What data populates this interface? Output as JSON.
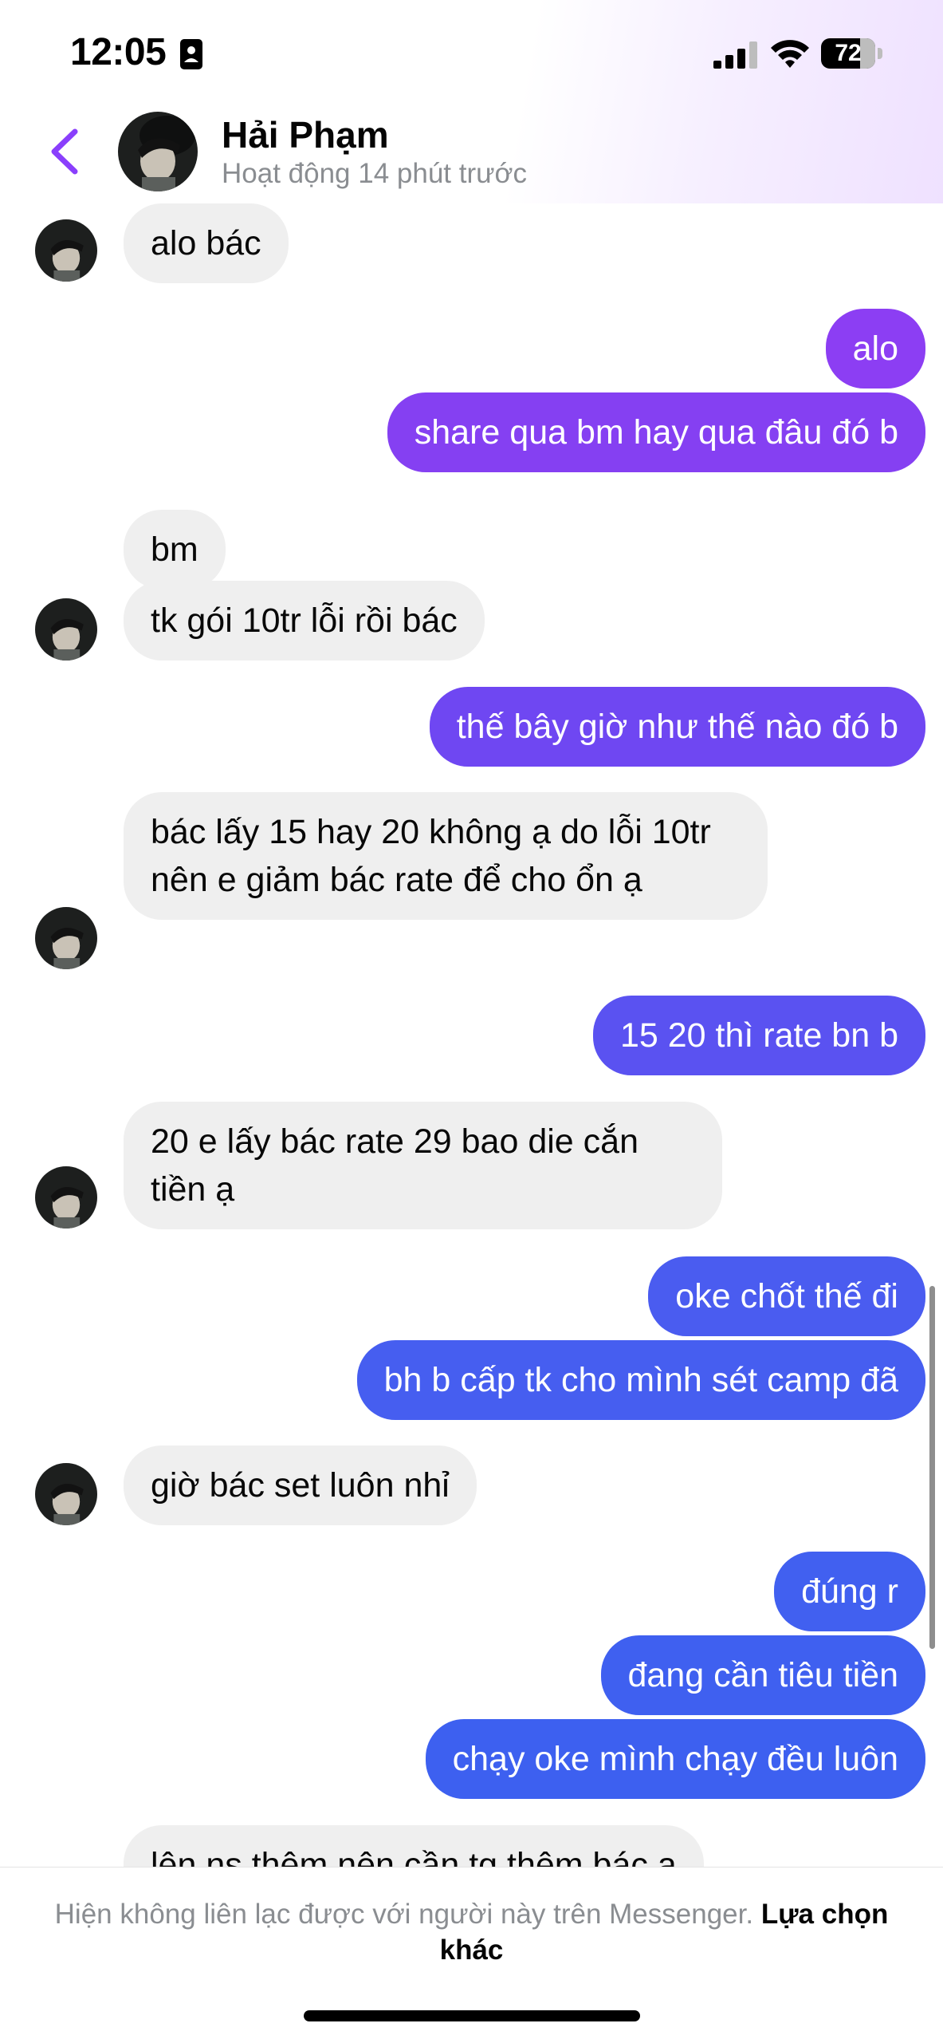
{
  "status_bar": {
    "time": "12:05",
    "battery_level": "72",
    "battery_fraction": 0.72
  },
  "header": {
    "contact_name": "Hải Phạm",
    "contact_status": "Hoạt động 14 phút trước"
  },
  "messages": [
    {
      "sender": "them",
      "text": "alo bác"
    },
    {
      "sender": "me",
      "text": "alo"
    },
    {
      "sender": "me",
      "text": "share qua bm hay qua đâu đó b"
    },
    {
      "sender": "them",
      "text": "bm"
    },
    {
      "sender": "them",
      "text": "tk gói 10tr lỗi rồi bác"
    },
    {
      "sender": "me",
      "text": "thế bây giờ như thế nào đó b"
    },
    {
      "sender": "them",
      "text": "bác lấy 15 hay 20 không ạ do lỗi 10tr nên e giảm bác rate để cho ổn ạ"
    },
    {
      "sender": "me",
      "text": "15 20 thì rate bn b"
    },
    {
      "sender": "them",
      "text": "20 e lấy bác rate 29 bao die cắn tiền ạ"
    },
    {
      "sender": "me",
      "text": "oke chốt thế đi"
    },
    {
      "sender": "me",
      "text": "bh b cấp tk cho mình sét camp đã"
    },
    {
      "sender": "them",
      "text": "giờ bác set luôn nhỉ"
    },
    {
      "sender": "me",
      "text": "đúng r"
    },
    {
      "sender": "me",
      "text": "đang cần tiêu tiền"
    },
    {
      "sender": "me",
      "text": "chạy oke mình chạy đều luôn"
    },
    {
      "sender": "them",
      "text": "lên ns thêm nên cần tg thêm bác ạ"
    }
  ],
  "footer": {
    "notice": "Hiện không liên lạc được với người này trên Messenger.",
    "link_label": "Lựa chọn khác"
  },
  "colors": {
    "accent": "#8a3ffc",
    "outgoing_top": "#8c3ef3",
    "outgoing_bottom": "#3f5ff0",
    "incoming": "#efefef",
    "muted_text": "#8a8d91"
  }
}
